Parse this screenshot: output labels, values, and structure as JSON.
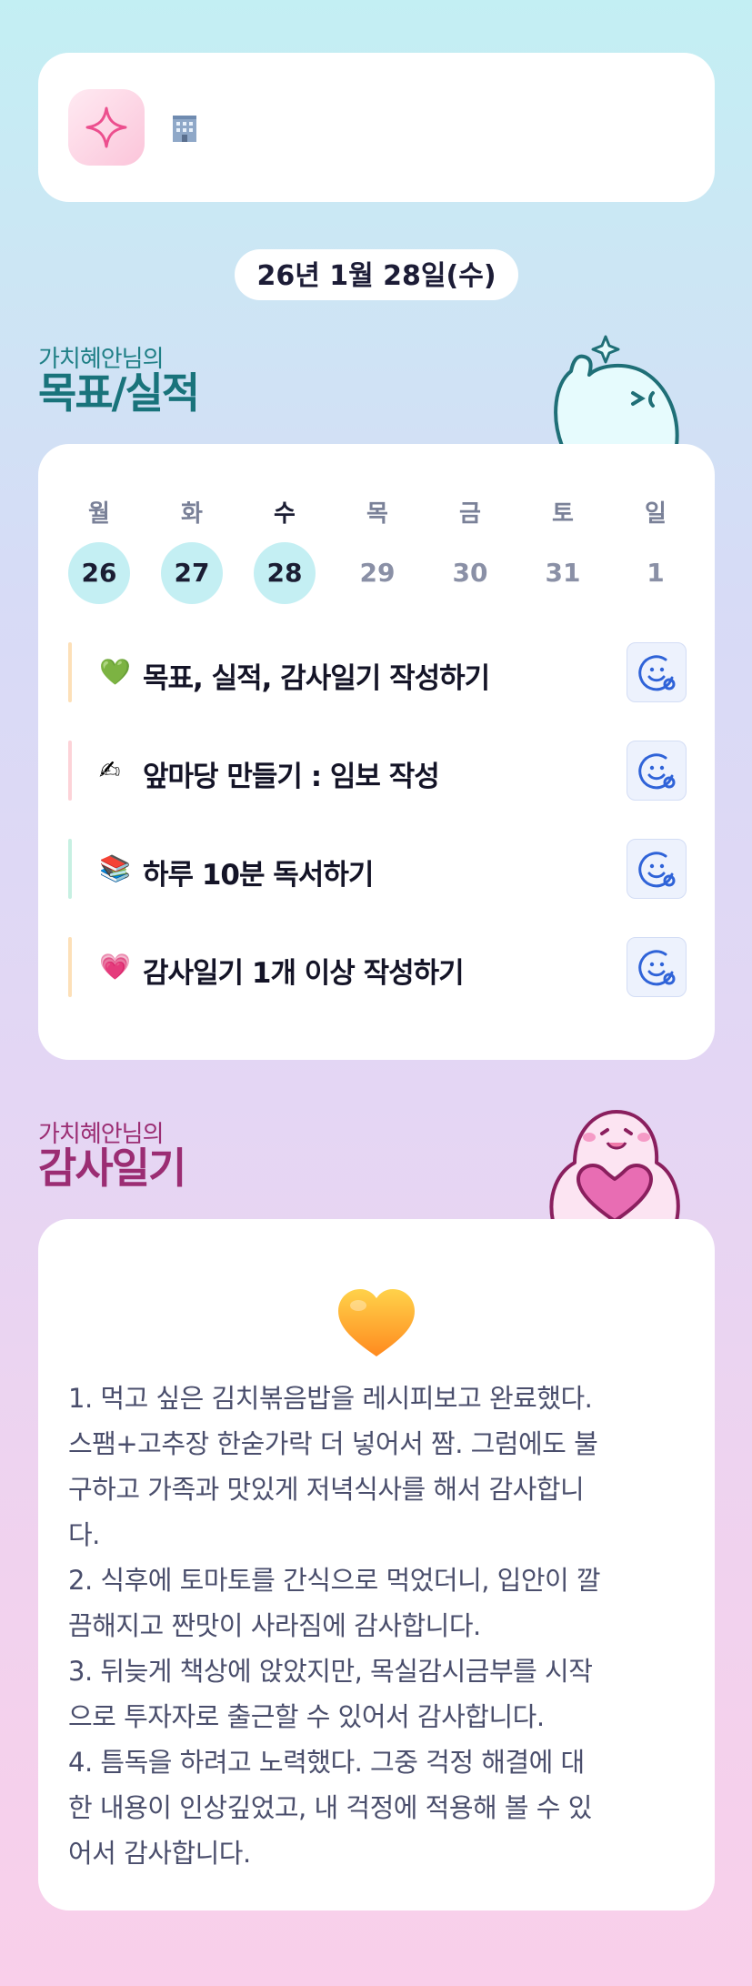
{
  "header": {
    "app_icon": "sparkle-icon",
    "building_icon": "office-building-icon"
  },
  "date_pill": "26년 1월 28일(수)",
  "goals_section": {
    "subtitle": "가치혜안님의",
    "title": "목표/실적"
  },
  "week": {
    "days": [
      {
        "label": "월",
        "num": "26",
        "active": true
      },
      {
        "label": "화",
        "num": "27",
        "active": true
      },
      {
        "label": "수",
        "num": "28",
        "active": true,
        "today": true
      },
      {
        "label": "목",
        "num": "29",
        "active": false
      },
      {
        "label": "금",
        "num": "30",
        "active": false
      },
      {
        "label": "토",
        "num": "31",
        "active": false
      },
      {
        "label": "일",
        "num": "1",
        "active": false
      }
    ]
  },
  "tasks": [
    {
      "emoji": "💚",
      "text": "목표, 실적, 감사일기 작성하기",
      "bar_color": "#fde0b8"
    },
    {
      "emoji": "✍",
      "text": "앞마당 만들기 : 임보 작성",
      "bar_color": "#fdd3d8"
    },
    {
      "emoji": "📚",
      "text": "하루 10분 독서하기",
      "bar_color": "#c7f0e2"
    },
    {
      "emoji": "💗",
      "text": "감사일기 1개 이상 작성하기",
      "bar_color": "#fde0b8"
    }
  ],
  "task_button_icon": "smile-face-icon",
  "gratitude_section": {
    "subtitle": "가치혜안님의",
    "title": "감사일기"
  },
  "gratitude": {
    "icon": "orange-heart-icon",
    "text": "1. 먹고 싶은 김치볶음밥을 레시피보고 완료했다.\n스팸+고추장 한숟가락 더 넣어서 짬. 그럼에도 불\n구하고 가족과 맛있게 저녁식사를 해서 감사합니\n다.\n2. 식후에 토마토를 간식으로 먹었더니, 입안이 깔\n끔해지고 짠맛이 사라짐에 감사합니다.\n3. 뒤늦게 책상에 앉았지만, 목실감시금부를 시작\n으로 투자자로 출근할 수 있어서 감사합니다.\n4. 틈독을 하려고 노력했다. 그중 걱정 해결에 대\n한 내용이 인상깊었고, 내 걱정에 적용해 볼 수 있\n어서 감사합니다."
  }
}
